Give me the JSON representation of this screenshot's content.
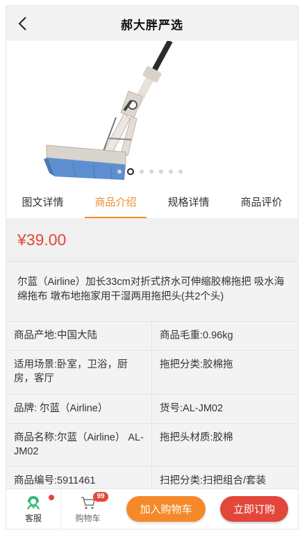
{
  "header": {
    "title": "郝大胖严选",
    "back_icon": "chevron-left-icon"
  },
  "carousel": {
    "slide_count": 7,
    "active_index": 1
  },
  "tabs": [
    {
      "label": "图文详情",
      "active": false
    },
    {
      "label": "商品介绍",
      "active": true
    },
    {
      "label": "规格详情",
      "active": false
    },
    {
      "label": "商品评价",
      "active": false
    }
  ],
  "product": {
    "price": "¥39.00",
    "description": "尔蓝（Airline）加长33cm对折式挤水可伸缩胶棉拖把 吸水海绵拖布 墩布地拖家用干湿两用拖把头(共2个头)"
  },
  "specs": [
    [
      "商品产地:中国大陆",
      "商品毛重:0.96kg"
    ],
    [
      "适用场景:卧室，卫浴，厨房，客厅",
      "拖把分类:胶棉拖"
    ],
    [
      "品牌: 尔蓝（Airline）",
      "货号:AL-JM02"
    ],
    [
      "商品名称:尔蓝（Airline） AL-JM02",
      "拖把头材质:胶棉"
    ],
    [
      "商品编号:5911461",
      "扫把分类:扫把组合/套装"
    ]
  ],
  "bottom_bar": {
    "service_label": "客服",
    "service_icon": "customer-service-icon",
    "cart_label": "购物车",
    "cart_icon": "shopping-cart-icon",
    "cart_count": "99",
    "add_to_cart_label": "加入购物车",
    "buy_now_label": "立即订购"
  },
  "colors": {
    "accent": "#f08c2c",
    "price": "#e2473b",
    "service_icon": "#2bb673"
  }
}
